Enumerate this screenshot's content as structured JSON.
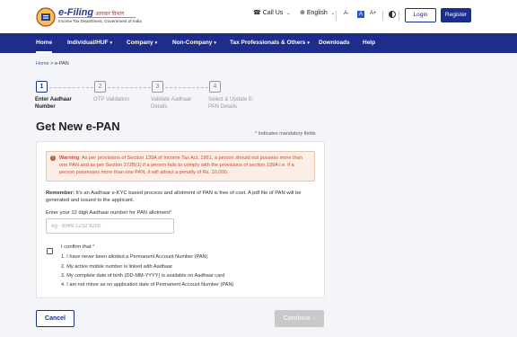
{
  "header": {
    "logo_title": "e-Filing",
    "logo_hindi": "आयकर विभाग",
    "logo_subtitle": "Income Tax Department, Government of India",
    "call_us": "Call Us",
    "language": "English",
    "font_decrease": "A-",
    "font_normal": "A",
    "font_increase": "A+",
    "login": "Login",
    "register": "Register"
  },
  "nav": {
    "items": [
      {
        "label": "Home"
      },
      {
        "label": "Individual/HUF"
      },
      {
        "label": "Company"
      },
      {
        "label": "Non-Company"
      },
      {
        "label": "Tax Professionals & Others"
      },
      {
        "label": "Downloads"
      },
      {
        "label": "Help"
      }
    ]
  },
  "breadcrumb": {
    "home": "Home",
    "separator": ">",
    "current": "e-PAN"
  },
  "stepper": {
    "steps": [
      {
        "number": "1",
        "label_line1": "Enter Aadhaar",
        "label_line2": "Number"
      },
      {
        "number": "2",
        "label_line1": "OTP Validation",
        "label_line2": ""
      },
      {
        "number": "3",
        "label_line1": "Validate Aadhaar",
        "label_line2": "Details"
      },
      {
        "number": "4",
        "label_line1": "Select & Update E-",
        "label_line2": "PAN Details"
      }
    ]
  },
  "page": {
    "title": "Get New e-PAN",
    "mandatory_note": "Indicates mandatory fields"
  },
  "form": {
    "warning_label": "Warning",
    "warning_text": ": As per provisions of Section 139A of Income Tax Act, 1961, a person should not possess more than one PAN and as per Section 272B(1) if a person fails to comply with the provisions of section 139A i.e. if a person possesses more than one PAN, it will attract a penalty of Rs. 10,000.",
    "remember_label": "Remember:",
    "remember_text": " It's an Aadhaar e-KYC based process and allotment of PAN is free of cost. A pdf file of PAN will be generated and issued to the applicant.",
    "aadhaar_label": "Enter your 12 digit Aadhaar number for PAN allotment",
    "aadhaar_placeholder": "eg - 8969 1232 9200",
    "confirm_label": "I confirm that",
    "confirm_items": [
      "1. I have never been allotted a Permanent Account Number (PAN)",
      "2. My active mobile number is linked with Aadhaar",
      "3. My complete date of birth (DD-MM-YYYY) is available on Aadhaar card",
      "4. I am not minor as on application date of Permanent Account Number (PAN)"
    ]
  },
  "actions": {
    "cancel": "Cancel",
    "continue": "Continue"
  },
  "colors": {
    "primary": "#1e2d8c",
    "warning": "#c44f2f",
    "warning_bg": "#fbeee6",
    "disabled": "#c9c9c9"
  }
}
